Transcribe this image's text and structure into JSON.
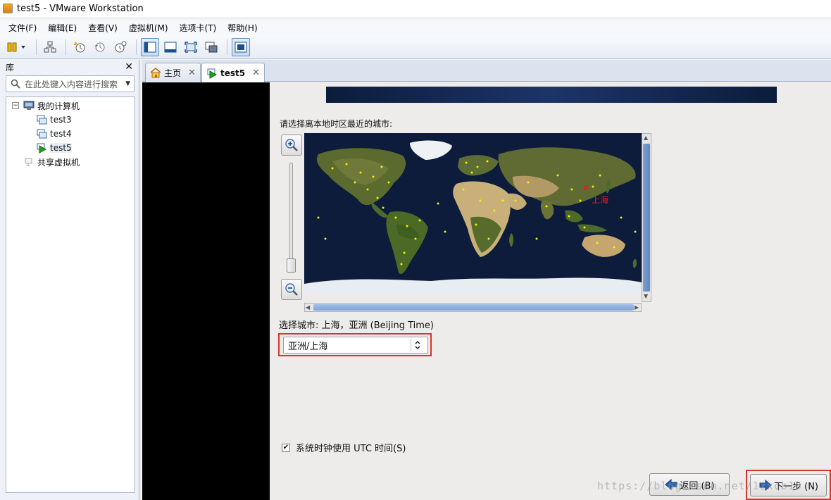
{
  "window": {
    "title": "test5 - VMware Workstation"
  },
  "menu": [
    "文件(F)",
    "编辑(E)",
    "查看(V)",
    "虚拟机(M)",
    "选项卡(T)",
    "帮助(H)"
  ],
  "library": {
    "title": "库",
    "close": "✕",
    "search_placeholder": "在此处键入内容进行搜索",
    "tree": {
      "root": "我的计算机",
      "root_toggle": "−",
      "children": [
        "test3",
        "test4",
        "test5"
      ],
      "shared": "共享虚拟机"
    }
  },
  "tabs": [
    {
      "label": "主页",
      "close": "✕"
    },
    {
      "label": "test5",
      "close": "✕"
    }
  ],
  "installer": {
    "prompt": "请选择离本地时区最近的城市:",
    "map_city_marker": "x",
    "map_city_label": "上海",
    "selected_city_text": "选择城市: 上海，亚洲 (Beijing Time)",
    "city_dropdown_value": "亚洲/上海",
    "utc_checkbox_label": "系统时钟使用 UTC 时间(S)",
    "utc_checked": "✔",
    "back_button": "返回 (B)",
    "next_button": "下一步 (N)",
    "watermark": "https://blog.csdn.net/1zxcb10"
  },
  "colors": {
    "highlight_red": "#d9342b",
    "ocean": "#0c1c3a",
    "banner": "#1d3468"
  }
}
